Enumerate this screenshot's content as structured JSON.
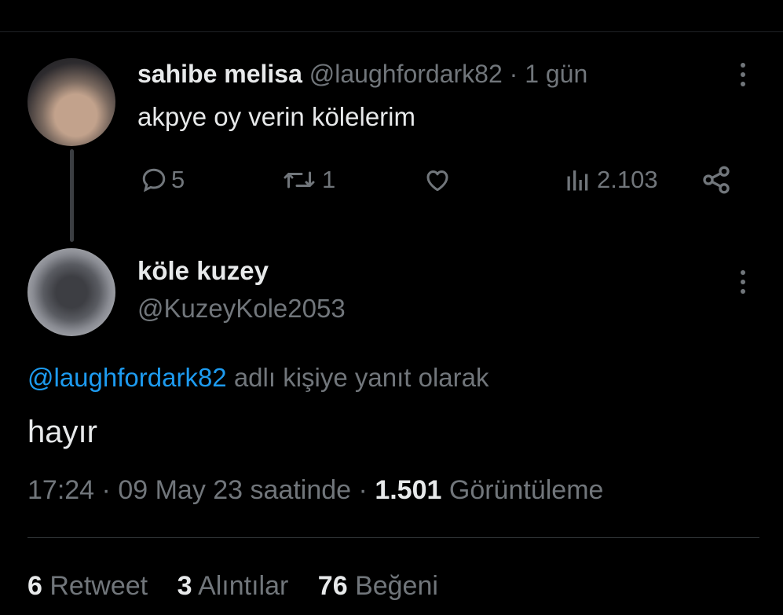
{
  "tweet1": {
    "display_name": "sahibe melisa",
    "handle": "@laughfordark82",
    "separator": "·",
    "time": "1 gün",
    "text": "akpye oy verin kölelerim",
    "replies": "5",
    "retweets": "1",
    "views": "2.103"
  },
  "tweet2": {
    "display_name": "köle kuzey",
    "handle": "@KuzeyKole2053",
    "reply_to_mention": "@laughfordark82",
    "reply_to_suffix": " adlı kişiye yanıt olarak",
    "text": "hayır",
    "time": "17:24",
    "separator": "·",
    "date": "09 May 23 saatinde",
    "separator2": "·",
    "view_count": "1.501",
    "view_label": "Görüntüleme"
  },
  "stats": {
    "retweet_count": "6",
    "retweet_label": "Retweet",
    "quote_count": "3",
    "quote_label": "Alıntılar",
    "like_count": "76",
    "like_label": "Beğeni"
  },
  "colors": {
    "background": "#000000",
    "text": "#e7e9ea",
    "muted": "#71767b",
    "link": "#1d9bf0"
  }
}
